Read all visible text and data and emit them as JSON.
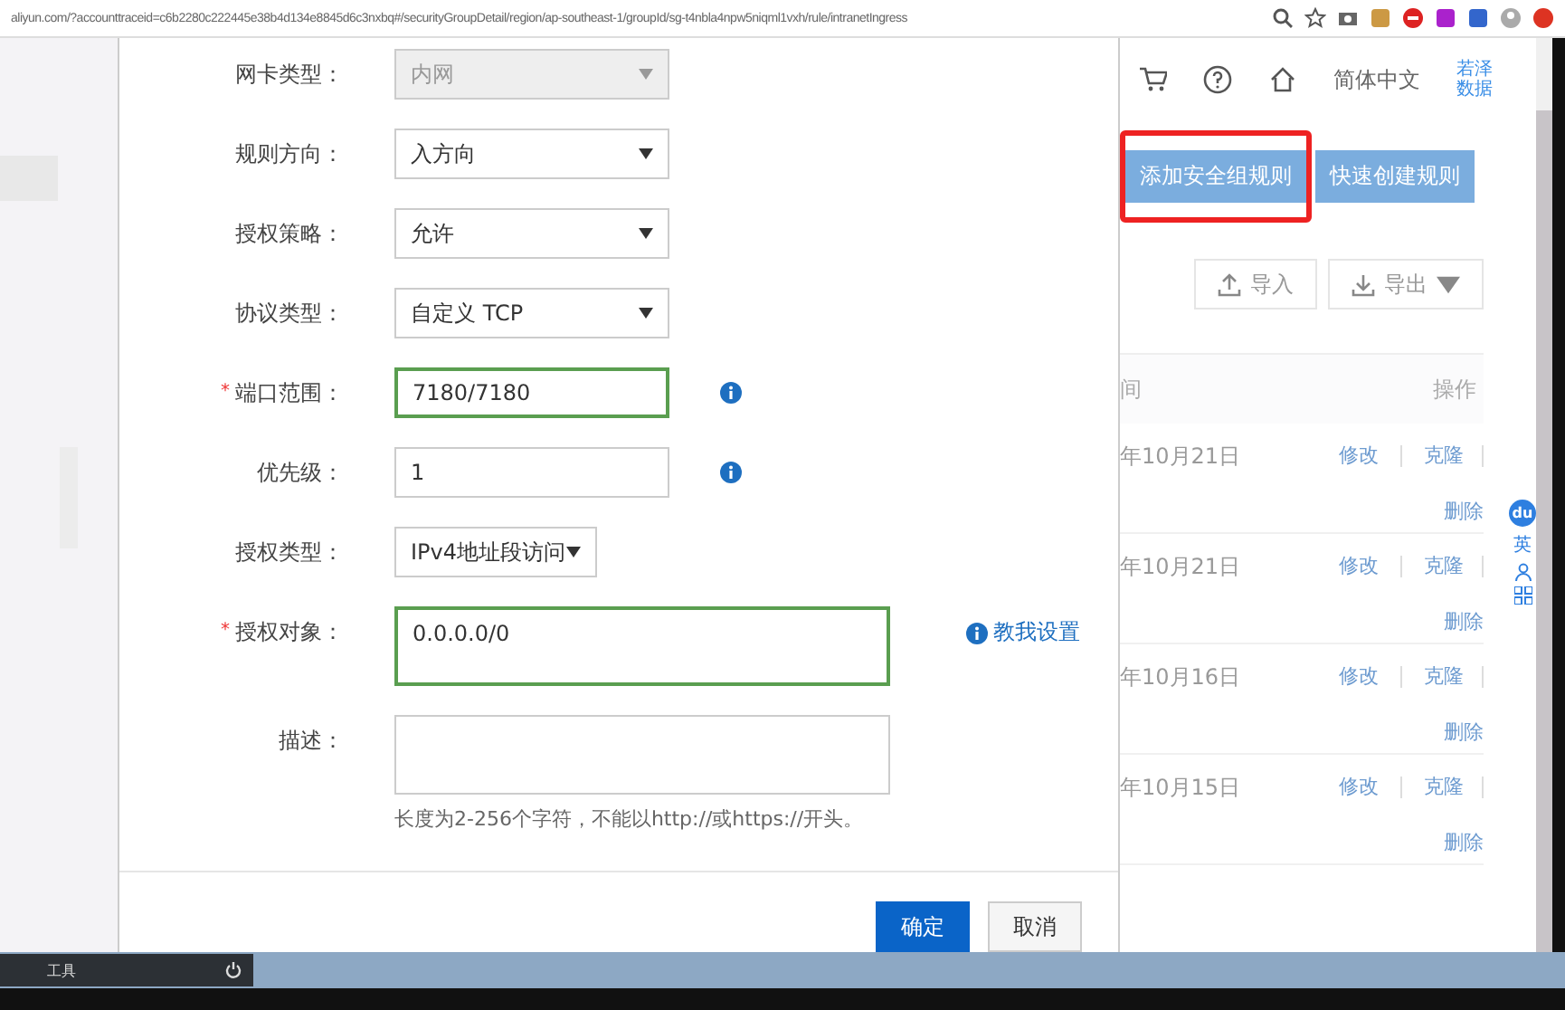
{
  "address_bar": {
    "url": "aliyun.com/?accounttraceid=c6b2280c222445e38b4d134e8845d6c3nxbq#/securityGroupDetail/region/ap-southeast-1/groupId/sg-t4nbla4npw5niqml1vxh/rule/intranetIngress"
  },
  "header": {
    "language": "简体中文",
    "logo": "若泽数据"
  },
  "actions": [
    {
      "label": "添加安全组规则",
      "highlighted": true
    },
    {
      "label": "快速创建规则",
      "highlighted": false
    }
  ],
  "toolbar": [
    {
      "label": "导入",
      "kind": "upload"
    },
    {
      "label": "导出",
      "kind": "download"
    }
  ],
  "table": {
    "columns": [
      "间",
      "操作"
    ],
    "rows": [
      {
        "date": "年10月21日",
        "links": [
          "修改",
          "克隆",
          "删除"
        ]
      },
      {
        "date": "年10月21日",
        "links": [
          "修改",
          "克隆",
          "删除"
        ]
      },
      {
        "date": "年10月16日",
        "links": [
          "修改",
          "克隆",
          "删除"
        ]
      },
      {
        "date": "年10月15日",
        "links": [
          "修改",
          "克隆",
          "删除"
        ]
      }
    ]
  },
  "dialog": {
    "fields": [
      {
        "label": "网卡类型：",
        "kind": "select",
        "value": "内网",
        "disabled": true,
        "valid": false
      },
      {
        "label": "规则方向：",
        "kind": "select",
        "value": "入方向",
        "disabled": false,
        "valid": false
      },
      {
        "label": "授权策略：",
        "kind": "select",
        "value": "允许",
        "disabled": false,
        "valid": false
      },
      {
        "label": "协议类型：",
        "kind": "select",
        "value": "自定义 TCP",
        "disabled": false,
        "valid": false
      },
      {
        "required_mark": "*",
        "label": "端口范围：",
        "kind": "input",
        "value": "7180/7180",
        "disabled": false,
        "valid": true,
        "info": true
      },
      {
        "label": "优先级：",
        "kind": "input",
        "value": "1",
        "disabled": false,
        "valid": false,
        "info": true
      },
      {
        "label": "授权类型：",
        "kind": "select-small",
        "value": "IPv4地址段访问",
        "disabled": false,
        "valid": false
      },
      {
        "required_mark": "*",
        "label": "授权对象：",
        "kind": "textarea",
        "value": "0.0.0.0/0",
        "disabled": false,
        "valid": true,
        "help_link": "教我设置"
      },
      {
        "label": "描述：",
        "kind": "textarea",
        "disabled": false,
        "valid": false,
        "hint": "长度为2-256个字符，不能以http://或https://开头。"
      }
    ],
    "buttons": [
      {
        "label": "确定",
        "primary": true
      },
      {
        "label": "取消",
        "primary": false
      }
    ]
  },
  "side_widget": {
    "items": [
      "du",
      "英"
    ]
  },
  "taskbar": {
    "items": [
      "工具"
    ]
  }
}
